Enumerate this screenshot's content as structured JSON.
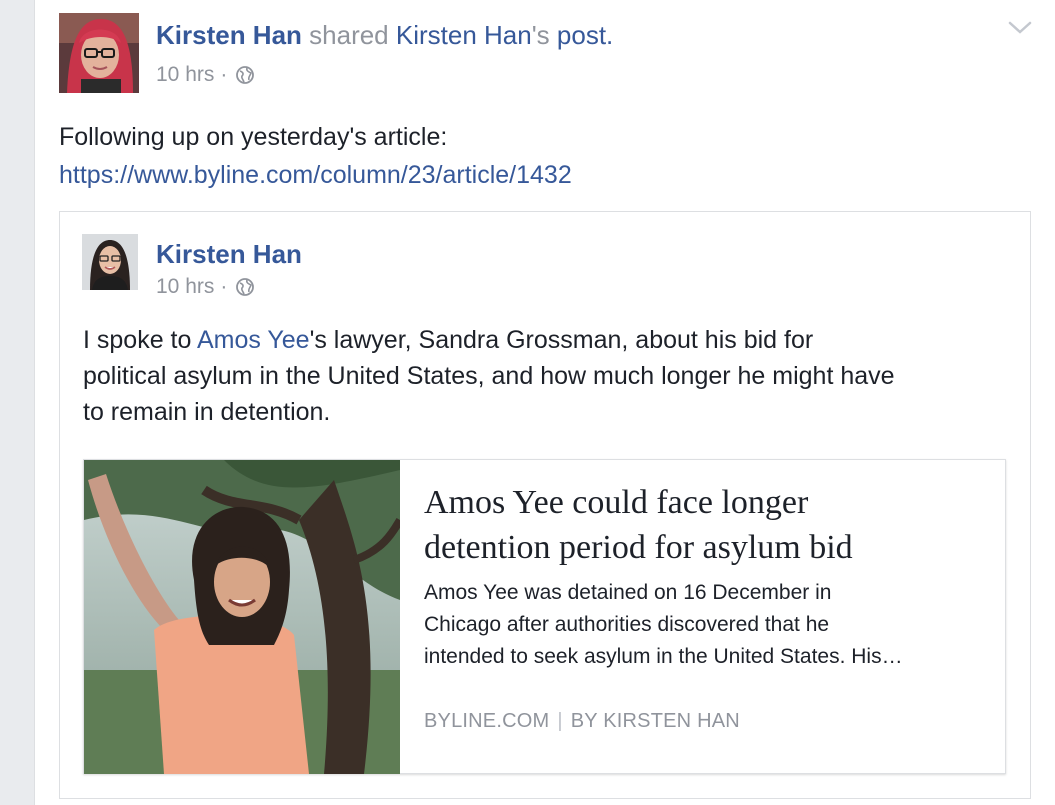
{
  "post": {
    "author": "Kirsten Han",
    "action": " shared ",
    "shared_author": "Kirsten Han",
    "shared_suffix": "'s",
    "shared_object": " post.",
    "time": "10 hrs",
    "dot": "·",
    "text": "Following up on yesterday's article:",
    "link": "https://www.byline.com/column/23/article/1432"
  },
  "shared_post": {
    "author": "Kirsten Han",
    "time": "10 hrs",
    "dot": "·",
    "text_line1_pre": "I spoke to ",
    "text_line1_mention": "Amos Yee",
    "text_line1_post": "'s lawyer, Sandra Grossman, about his bid for",
    "text_line2": "political asylum in the United States, and how much longer he might have",
    "text_line3": "to remain in detention."
  },
  "article": {
    "title_line1": "Amos Yee could face longer",
    "title_line2": "detention period for asylum bid",
    "desc_line1": "Amos Yee was detained on 16 December in",
    "desc_line2": "Chicago after authorities discovered that he",
    "desc_line3": "intended to seek asylum in the United States. His…",
    "source": "BYLINE.COM",
    "separator": "|",
    "byline": "BY KIRSTEN HAN"
  },
  "icons": {
    "globe": "globe-icon",
    "chevron": "chevron-down-icon"
  },
  "colors": {
    "link": "#365899",
    "muted": "#90949c",
    "text": "#1d2129",
    "background": "#e9ebee"
  }
}
